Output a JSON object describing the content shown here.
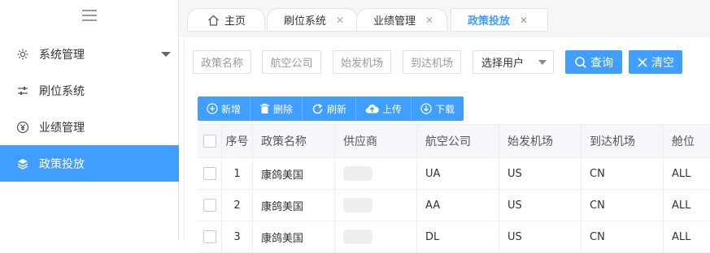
{
  "sidebar": {
    "items": [
      {
        "label": "系统管理",
        "icon": "gear-icon",
        "has_caret": true,
        "active": false
      },
      {
        "label": "刷位系统",
        "icon": "sliders-icon",
        "active": false
      },
      {
        "label": "业绩管理",
        "icon": "yen-icon",
        "active": false
      },
      {
        "label": "政策投放",
        "icon": "layers-icon",
        "active": true
      }
    ]
  },
  "tabs": [
    {
      "label": "主页",
      "icon": "home-icon"
    },
    {
      "label": "刷位系统",
      "close": "✕"
    },
    {
      "label": "业绩管理",
      "close": "✕"
    },
    {
      "label": "政策投放",
      "close": "✕",
      "active": true
    }
  ],
  "filters": {
    "policy_name_placeholder": "政策名称",
    "airline_placeholder": "航空公司",
    "origin_placeholder": "始发机场",
    "destination_placeholder": "到达机场",
    "user_select": "选择用户",
    "query_label": "查询",
    "clear_label": "清空"
  },
  "toolbar": {
    "add": "新增",
    "delete": "删除",
    "refresh": "刷新",
    "upload": "上传",
    "download": "下载"
  },
  "table": {
    "columns": [
      "序号",
      "政策名称",
      "供应商",
      "航空公司",
      "始发机场",
      "到达机场",
      "舱位"
    ],
    "rows": [
      {
        "index": "1",
        "name": "康鸽美国",
        "airline": "UA",
        "origin": "US",
        "dest": "CN",
        "cabin": "ALL"
      },
      {
        "index": "2",
        "name": "康鸽美国",
        "airline": "AA",
        "origin": "US",
        "dest": "CN",
        "cabin": "ALL"
      },
      {
        "index": "3",
        "name": "康鸽美国",
        "airline": "DL",
        "origin": "US",
        "dest": "CN",
        "cabin": "ALL"
      }
    ]
  },
  "colors": {
    "accent": "#409eff",
    "header_bg": "#f5f7fa"
  }
}
